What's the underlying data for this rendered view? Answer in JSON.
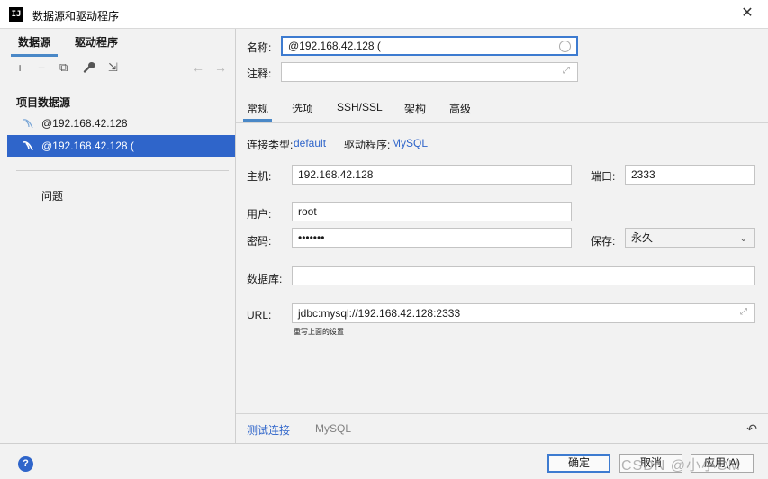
{
  "window": {
    "title": "数据源和驱动程序",
    "app_icon": "IJ"
  },
  "left": {
    "tabs": [
      "数据源",
      "驱动程序"
    ],
    "toolbar": {
      "add": "+",
      "remove": "−",
      "copy": "⧉",
      "wrench": "🔧",
      "import": "⇲",
      "back": "←",
      "forward": "→"
    },
    "section_title": "项目数据源",
    "items": [
      {
        "label": "@192.168.42.128"
      },
      {
        "label": "@192.168.42.128 ("
      }
    ],
    "problems_label": "问题"
  },
  "right": {
    "name_label": "名称:",
    "name_value": "@192.168.42.128 (",
    "comment_label": "注释:",
    "comment_value": "",
    "tabs": [
      "常规",
      "选项",
      "SSH/SSL",
      "架构",
      "高级"
    ],
    "conn_type_label": "连接类型:",
    "conn_type_value": "default",
    "driver_label": "驱动程序:",
    "driver_value": "MySQL",
    "host_label": "主机:",
    "host_value": "192.168.42.128",
    "port_label": "端口:",
    "port_value": "2333",
    "user_label": "用户:",
    "user_value": "root",
    "password_label": "密码:",
    "password_value": "•••••••",
    "save_label": "保存:",
    "save_value": "永久",
    "database_label": "数据库:",
    "database_value": "",
    "url_label": "URL:",
    "url_value": "jdbc:mysql://192.168.42.128:2333",
    "url_hint": "重写上面的设置",
    "test_conn": "测试连接",
    "driver_footer": "MySQL"
  },
  "footer": {
    "help": "?",
    "ok": "确定",
    "cancel": "取消",
    "apply": "应用(A)",
    "watermark": "CSDN @小小CM"
  },
  "colors": {
    "accent": "#2f65ca",
    "focus_border": "#3d7bd0",
    "tab_underline": "#4a88c7"
  }
}
